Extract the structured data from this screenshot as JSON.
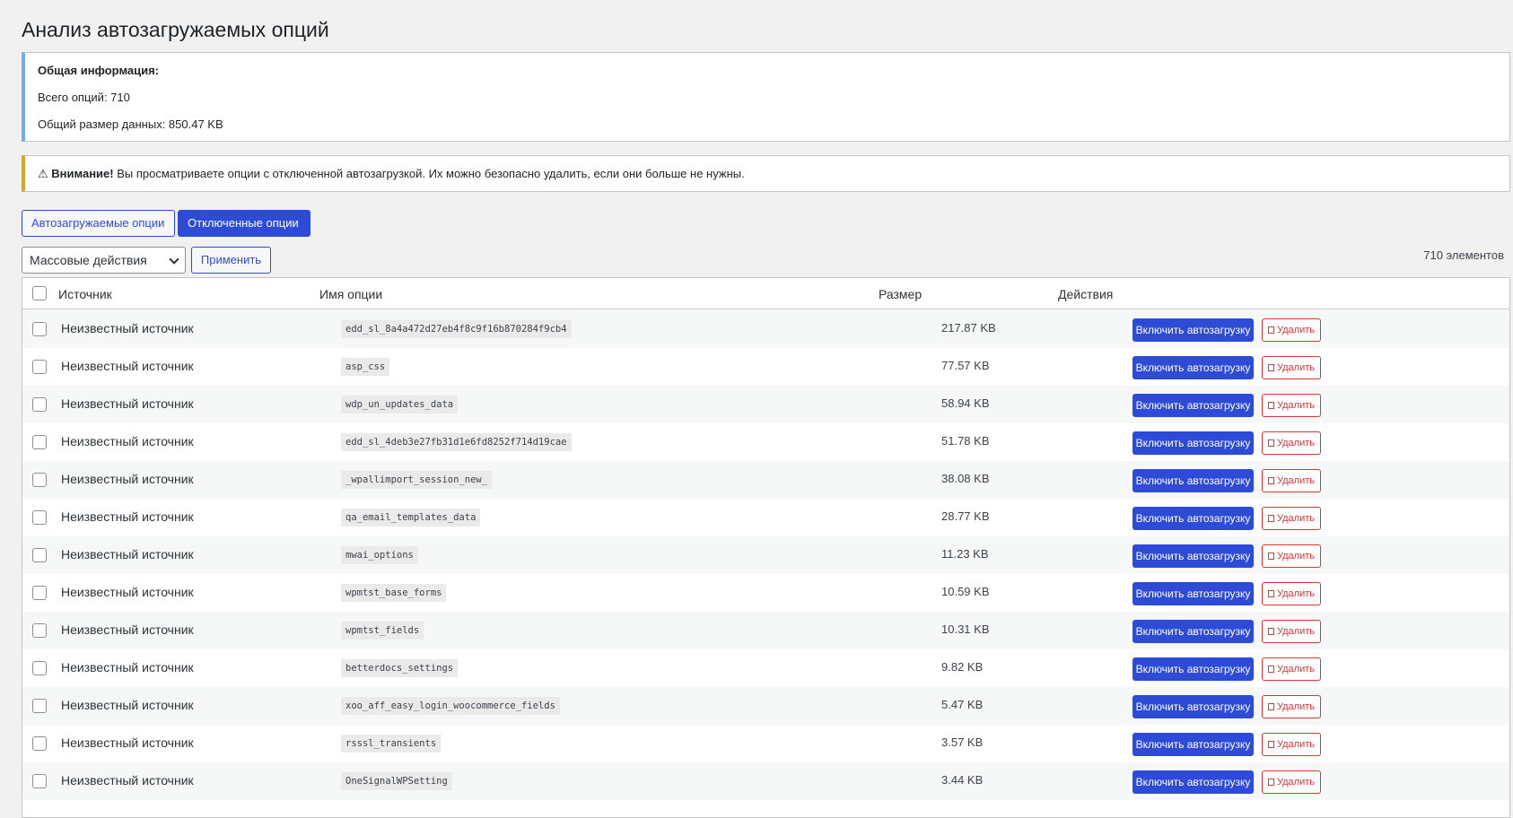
{
  "page": {
    "title": "Анализ автозагружаемых опций"
  },
  "info": {
    "title": "Общая информация:",
    "total_options": "Всего опций: 710",
    "total_size": "Общий размер данных: 850.47 KB"
  },
  "notice": {
    "icon": "⚠",
    "strong": "Внимание!",
    "text": " Вы просматриваете опции с отключенной автозагрузкой. Их можно безопасно удалить, если они больше не нужны."
  },
  "tabs": {
    "autoload_label": "Автозагружаемые опции",
    "disabled_label": "Отключенные опции"
  },
  "bulk": {
    "select_value": "Массовые действия",
    "apply_label": "Применить",
    "count": "710 элементов"
  },
  "table": {
    "headers": {
      "source": "Источник",
      "option": "Имя опции",
      "size": "Размер",
      "actions": "Действия"
    },
    "enable_label": "Включить автозагрузку",
    "delete_label": "Удалить",
    "rows": [
      {
        "source": "Неизвестный источник",
        "option": "edd_sl_8a4a472d27eb4f8c9f16b870284f9cb4",
        "size": "217.87 KB"
      },
      {
        "source": "Неизвестный источник",
        "option": "asp_css",
        "size": "77.57 KB"
      },
      {
        "source": "Неизвестный источник",
        "option": "wdp_un_updates_data",
        "size": "58.94 KB"
      },
      {
        "source": "Неизвестный источник",
        "option": "edd_sl_4deb3e27fb31d1e6fd8252f714d19cae",
        "size": "51.78 KB"
      },
      {
        "source": "Неизвестный источник",
        "option": "_wpallimport_session_new_",
        "size": "38.08 KB"
      },
      {
        "source": "Неизвестный источник",
        "option": "qa_email_templates_data",
        "size": "28.77 KB"
      },
      {
        "source": "Неизвестный источник",
        "option": "mwai_options",
        "size": "11.23 KB"
      },
      {
        "source": "Неизвестный источник",
        "option": "wpmtst_base_forms",
        "size": "10.59 KB"
      },
      {
        "source": "Неизвестный источник",
        "option": "wpmtst_fields",
        "size": "10.31 KB"
      },
      {
        "source": "Неизвестный источник",
        "option": "betterdocs_settings",
        "size": "9.82 KB"
      },
      {
        "source": "Неизвестный источник",
        "option": "xoo_aff_easy_login_woocommerce_fields",
        "size": "5.47 KB"
      },
      {
        "source": "Неизвестный источник",
        "option": "rsssl_transients",
        "size": "3.57 KB"
      },
      {
        "source": "Неизвестный источник",
        "option": "OneSignalWPSetting",
        "size": "3.44 KB"
      }
    ]
  }
}
